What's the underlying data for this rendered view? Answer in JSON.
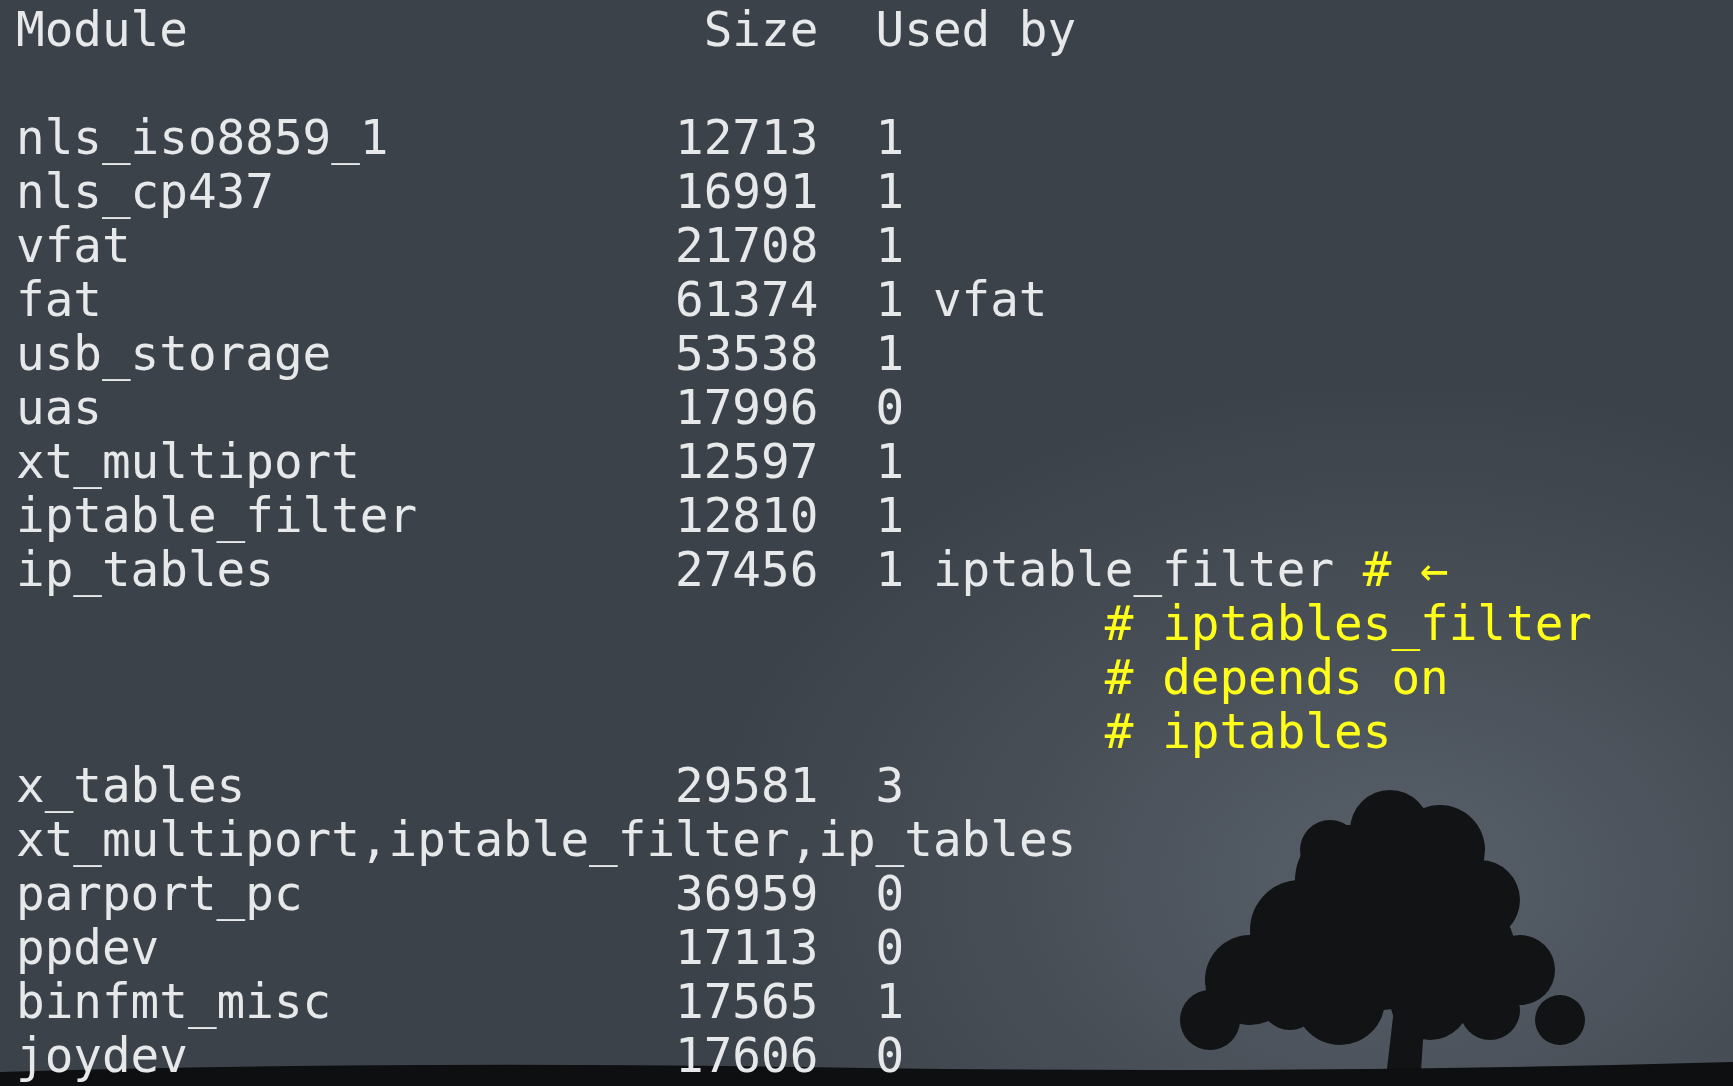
{
  "header": {
    "module": "Module",
    "size": "Size",
    "used_by": "Used by"
  },
  "lines": [
    {
      "kind": "module",
      "module": "nls_iso8859_1",
      "size": "12713",
      "count": "1"
    },
    {
      "kind": "module",
      "module": "nls_cp437",
      "size": "16991",
      "count": "1"
    },
    {
      "kind": "module",
      "module": "vfat",
      "size": "21708",
      "count": "1"
    },
    {
      "kind": "module",
      "module": "fat",
      "size": "61374",
      "count": "1",
      "deps": "vfat"
    },
    {
      "kind": "module",
      "module": "usb_storage",
      "size": "53538",
      "count": "1"
    },
    {
      "kind": "module",
      "module": "uas",
      "size": "17996",
      "count": "0"
    },
    {
      "kind": "module",
      "module": "xt_multiport",
      "size": "12597",
      "count": "1"
    },
    {
      "kind": "module",
      "module": "iptable_filter",
      "size": "12810",
      "count": "1"
    },
    {
      "kind": "module",
      "module": "ip_tables",
      "size": "27456",
      "count": "1",
      "deps": "iptable_filter",
      "comment": "# ←"
    },
    {
      "kind": "comment",
      "text": "# iptables_filter"
    },
    {
      "kind": "comment",
      "text": "# depends on"
    },
    {
      "kind": "comment",
      "text": "# iptables"
    },
    {
      "kind": "module",
      "module": "x_tables",
      "size": "29581",
      "count": "3"
    },
    {
      "kind": "wrap",
      "text": "xt_multiport,iptable_filter,ip_tables"
    },
    {
      "kind": "module",
      "module": "parport_pc",
      "size": "36959",
      "count": "0"
    },
    {
      "kind": "module",
      "module": "ppdev",
      "size": "17113",
      "count": "0"
    },
    {
      "kind": "module",
      "module": "binfmt_misc",
      "size": "17565",
      "count": "1"
    },
    {
      "kind": "module",
      "module": "joydev",
      "size": "17606",
      "count": "0"
    }
  ]
}
